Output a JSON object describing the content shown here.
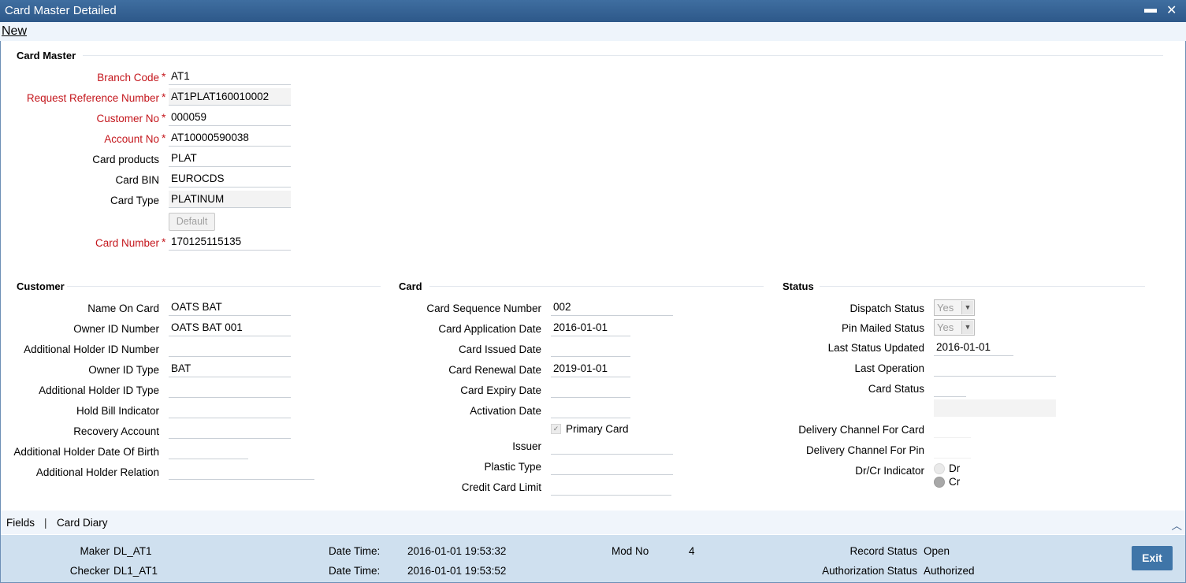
{
  "window": {
    "title": "Card Master Detailed",
    "minimize": "▬",
    "close": "✕"
  },
  "menu": {
    "new_label": "New"
  },
  "card_master": {
    "section_title": "Card Master",
    "branch_code": {
      "label": "Branch Code",
      "value": "AT1"
    },
    "request_ref": {
      "label": "Request Reference Number",
      "value": "AT1PLAT160010002"
    },
    "customer_no": {
      "label": "Customer No",
      "value": "000059"
    },
    "account_no": {
      "label": "Account No",
      "value": "AT10000590038"
    },
    "card_products": {
      "label": "Card products",
      "value": "PLAT"
    },
    "card_bin": {
      "label": "Card BIN",
      "value": "EUROCDS"
    },
    "card_type": {
      "label": "Card Type",
      "value": "PLATINUM"
    },
    "default_button": "Default",
    "card_number": {
      "label": "Card Number",
      "value": "170125115135"
    },
    "required_marker": "*"
  },
  "customer": {
    "section_title": "Customer",
    "name_on_card": {
      "label": "Name On Card",
      "value": "OATS BAT"
    },
    "owner_id_number": {
      "label": "Owner ID Number",
      "value": "OATS BAT 001"
    },
    "add_holder_id_number": {
      "label": "Additional Holder ID Number",
      "value": ""
    },
    "owner_id_type": {
      "label": "Owner ID Type",
      "value": "BAT"
    },
    "add_holder_id_type": {
      "label": "Additional Holder ID Type",
      "value": ""
    },
    "hold_bill_indicator": {
      "label": "Hold Bill Indicator",
      "value": ""
    },
    "recovery_account": {
      "label": "Recovery Account",
      "value": ""
    },
    "add_holder_dob": {
      "label": "Additional Holder Date Of Birth",
      "value": ""
    },
    "add_holder_relation": {
      "label": "Additional Holder Relation",
      "value": ""
    }
  },
  "card": {
    "section_title": "Card",
    "card_sequence_number": {
      "label": "Card Sequence Number",
      "value": "002"
    },
    "card_application_date": {
      "label": "Card Application Date",
      "value": "2016-01-01"
    },
    "card_issued_date": {
      "label": "Card Issued Date",
      "value": ""
    },
    "card_renewal_date": {
      "label": "Card Renewal Date",
      "value": "2019-01-01"
    },
    "card_expiry_date": {
      "label": "Card Expiry Date",
      "value": ""
    },
    "activation_date": {
      "label": "Activation Date",
      "value": ""
    },
    "primary_card": {
      "label": "Primary Card",
      "checked": true
    },
    "issuer": {
      "label": "Issuer",
      "value": ""
    },
    "plastic_type": {
      "label": "Plastic Type",
      "value": ""
    },
    "credit_card_limit": {
      "label": "Credit Card Limit",
      "value": ""
    }
  },
  "status": {
    "section_title": "Status",
    "dispatch_status": {
      "label": "Dispatch Status",
      "value": "Yes"
    },
    "pin_mailed_status": {
      "label": "Pin Mailed Status",
      "value": "Yes"
    },
    "last_status_updated": {
      "label": "Last Status Updated",
      "value": "2016-01-01"
    },
    "last_operation": {
      "label": "Last Operation",
      "value": ""
    },
    "card_status": {
      "label": "Card Status",
      "value": ""
    },
    "delivery_channel_card": {
      "label": "Delivery Channel For Card",
      "value": ""
    },
    "delivery_channel_pin": {
      "label": "Delivery Channel For Pin",
      "value": ""
    },
    "dr_cr_indicator": {
      "label": "Dr/Cr Indicator",
      "options": [
        "Dr",
        "Cr"
      ],
      "selected": "Cr"
    }
  },
  "tabs": {
    "fields": "Fields",
    "separator": "|",
    "card_diary": "Card Diary"
  },
  "footer": {
    "maker_label": "Maker",
    "maker": "DL_AT1",
    "checker_label": "Checker",
    "checker": "DL1_AT1",
    "date_time_label": "Date Time:",
    "maker_datetime": "2016-01-01 19:53:32",
    "checker_datetime": "2016-01-01 19:53:52",
    "mod_no_label": "Mod No",
    "mod_no": "4",
    "record_status_label": "Record Status",
    "record_status": "Open",
    "auth_status_label": "Authorization Status",
    "auth_status": "Authorized",
    "exit_label": "Exit"
  }
}
